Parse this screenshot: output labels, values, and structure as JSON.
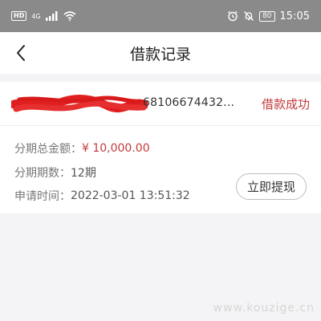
{
  "status_bar": {
    "hd_badge": "HD",
    "network_label": "4G",
    "battery_level": "80",
    "time": "15:05",
    "icons": [
      "signal-icon",
      "wifi-icon",
      "alarm-icon",
      "mute-bell-icon",
      "battery-icon"
    ]
  },
  "nav": {
    "back_icon": "chevron-left-icon",
    "title": "借款记录"
  },
  "record": {
    "order_number": "68106674432...",
    "status": "借款成功",
    "total_amount_label": "分期总金额：",
    "total_amount_value": "¥ 10,000.00",
    "installments_label": "分期期数：",
    "installments_value": "12期",
    "apply_time_label": "申请时间：",
    "apply_time_value": "2022-03-01 13:51:32",
    "withdraw_label": "立即提现"
  },
  "watermark": "www.kouzige.cn",
  "colors": {
    "accent": "#c33a3a",
    "status_bar": "#8a8a8a",
    "background": "#f4f4f6",
    "redaction": "#e02020"
  }
}
